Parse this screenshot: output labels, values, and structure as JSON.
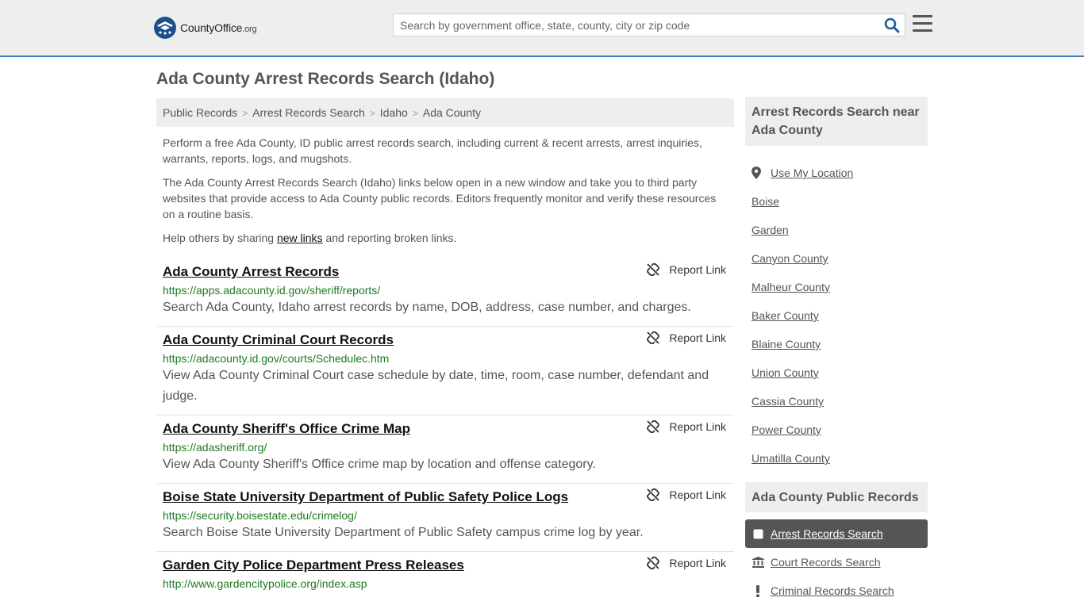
{
  "header": {
    "logo_main": "CountyOffice",
    "logo_tld": ".org",
    "search_placeholder": "Search by government office, state, county, city or zip code"
  },
  "page_title": "Ada County Arrest Records Search (Idaho)",
  "breadcrumb": [
    "Public Records",
    "Arrest Records Search",
    "Idaho",
    "Ada County"
  ],
  "intro": {
    "p1": "Perform a free Ada County, ID public arrest records search, including current & recent arrests, arrest inquiries, warrants, reports, logs, and mugshots.",
    "p2": "The Ada County Arrest Records Search (Idaho) links below open in a new window and take you to third party websites that provide access to Ada County public records. Editors frequently monitor and verify these resources on a routine basis.",
    "p3_before": "Help others by sharing ",
    "p3_link": "new links",
    "p3_after": " and reporting broken links."
  },
  "report_label": "Report Link",
  "results": [
    {
      "title": "Ada County Arrest Records",
      "url": "https://apps.adacounty.id.gov/sheriff/reports/",
      "desc": "Search Ada County, Idaho arrest records by name, DOB, address, case number, and charges."
    },
    {
      "title": "Ada County Criminal Court Records",
      "url": "https://adacounty.id.gov/courts/Schedulec.htm",
      "desc": "View Ada County Criminal Court case schedule by date, time, room, case number, defendant and judge."
    },
    {
      "title": "Ada County Sheriff's Office Crime Map",
      "url": "https://adasheriff.org/",
      "desc": "View Ada County Sheriff's Office crime map by location and offense category."
    },
    {
      "title": "Boise State University Department of Public Safety Police Logs",
      "url": "https://security.boisestate.edu/crimelog/",
      "desc": "Search Boise State University Department of Public Safety campus crime log by year."
    },
    {
      "title": "Garden City Police Department Press Releases",
      "url": "http://www.gardencitypolice.org/index.asp",
      "desc": ""
    }
  ],
  "sidebar": {
    "nearby_heading": "Arrest Records Search near Ada County",
    "use_location": "Use My Location",
    "nearby": [
      "Boise",
      "Garden",
      "Canyon County",
      "Malheur County",
      "Baker County",
      "Blaine County",
      "Union County",
      "Cassia County",
      "Power County",
      "Umatilla County"
    ],
    "records_heading": "Ada County Public Records",
    "records": [
      {
        "label": "Arrest Records Search",
        "icon": "checkbox-icon",
        "active": true
      },
      {
        "label": "Court Records Search",
        "icon": "courthouse-icon",
        "active": false
      },
      {
        "label": "Criminal Records Search",
        "icon": "exclamation-icon",
        "active": false
      }
    ]
  },
  "colors": {
    "accent": "#3b7bb6",
    "url_green": "#1e7a1e",
    "active_bg": "#555555"
  }
}
